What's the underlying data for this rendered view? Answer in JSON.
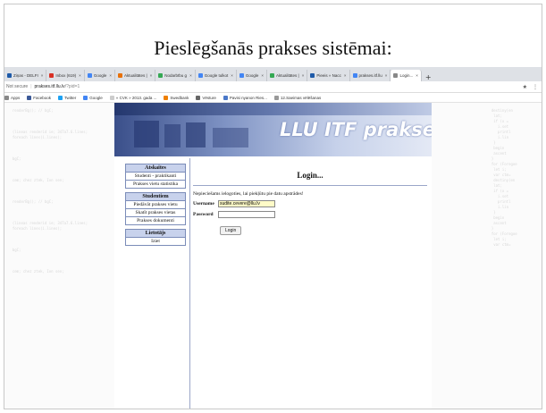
{
  "slide": {
    "title": "Pieslēgšanās prakses sistēmai:"
  },
  "browser": {
    "tabs": [
      {
        "label": "Ziņas - DELFI",
        "color": "#1e5aa8"
      },
      {
        "label": "Inbox (619)",
        "color": "#d93025"
      },
      {
        "label": "Google",
        "color": "#4285f4"
      },
      {
        "label": "Aktualitātes |",
        "color": "#e8710a"
      },
      {
        "label": "Nodarbību g",
        "color": "#34a853"
      },
      {
        "label": "Google tulkot",
        "color": "#4285f4"
      },
      {
        "label": "Google",
        "color": "#4285f4"
      },
      {
        "label": "Aktualitātes |",
        "color": "#34a853"
      },
      {
        "label": "Pieeis » Nacc",
        "color": "#1e5aa8"
      },
      {
        "label": "prakses.itf.llu",
        "color": "#4285f4"
      },
      {
        "label": "Login...",
        "color": "#888888",
        "active": true
      }
    ],
    "new_tab": "+",
    "address": {
      "not_secure": "Not secure",
      "url_host": "prakses.itf.llu.lv",
      "url_path": "/?pid=1",
      "star_icon": "★",
      "ext_icon": "⋮"
    },
    "bookmarks": [
      {
        "label": "Apps",
        "color": "#888888"
      },
      {
        "label": "Facebook",
        "color": "#3b5998"
      },
      {
        "label": "Twitter",
        "color": "#1da1f2"
      },
      {
        "label": "Google",
        "color": "#4285f4"
      },
      {
        "label": "« CVK » 2013. gada ...",
        "color": "#cccccc"
      },
      {
        "label": "Swedbank",
        "color": "#ee7f00"
      },
      {
        "label": "Vēsture",
        "color": "#666666"
      },
      {
        "label": "Pavisi nyanon Ries...",
        "color": "#4a78c8"
      },
      {
        "label": "12.Saeimas vēlēšanas",
        "color": "#999999"
      }
    ]
  },
  "site": {
    "banner_title": "LLU ITF prakses",
    "sidebar": [
      {
        "heading": "Atskaites",
        "links": [
          "Studenti - praktikanti",
          "Prakses vietu statistika"
        ]
      },
      {
        "heading": "Studentiem",
        "links": [
          "Piedāvāt prakses vietu",
          "Skatīt prakses vietas",
          "Prakses dokumenti"
        ]
      },
      {
        "heading": "Lietotājs",
        "links": [
          "Iziet"
        ]
      }
    ],
    "main": {
      "title": "Login...",
      "message": "Nepieciešams ielogoties, lai piekļūtu pie datu apstrādes!",
      "username_label": "Username",
      "username_value": "sudite.cevere@llu.lv",
      "password_label": "Password",
      "login_button": "Login"
    }
  }
}
